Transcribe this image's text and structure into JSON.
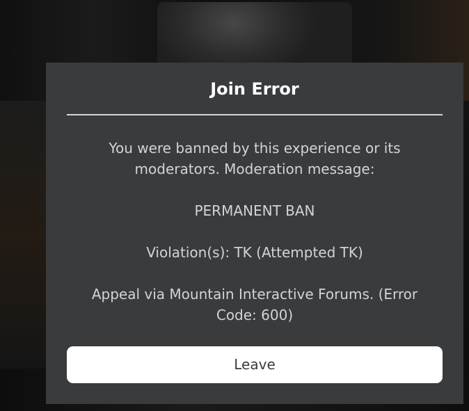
{
  "dialog": {
    "title": "Join Error",
    "message_line1": "You were banned by this experience or its moderators. Moderation message:",
    "message_line2": "PERMANENT BAN",
    "message_line3": "Violation(s): TK (Attempted TK)",
    "message_line4": "Appeal via Mountain Interactive Forums. (Error Code: 600)",
    "leave_label": "Leave"
  },
  "colors": {
    "dialog_background": "#393b3d",
    "title_text": "#ffffff",
    "body_text": "#d4d4d4",
    "button_background": "#ffffff",
    "button_text": "#393b3d"
  }
}
